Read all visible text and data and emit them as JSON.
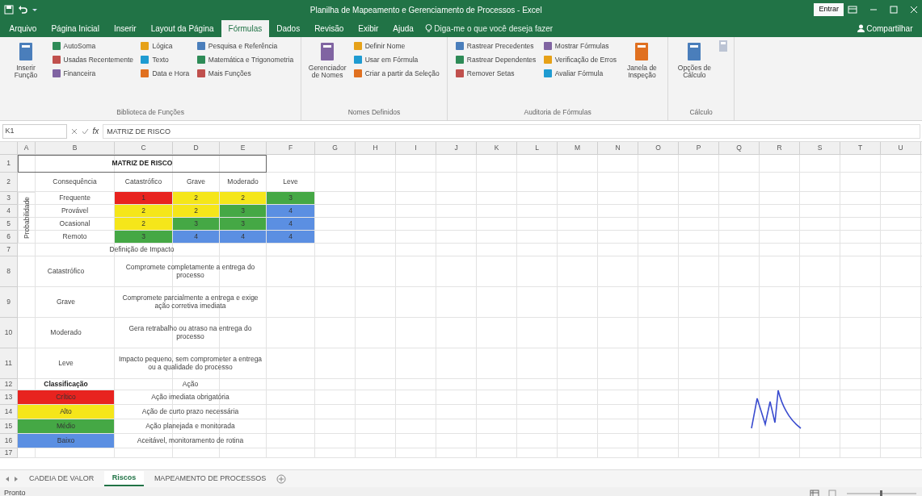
{
  "window": {
    "title": "Planilha de Mapeamento e Gerenciamento de Processos - Excel",
    "sign_in": "Entrar"
  },
  "ribbon_tabs": [
    {
      "label": "Arquivo",
      "selected": false
    },
    {
      "label": "Página Inicial",
      "selected": false
    },
    {
      "label": "Inserir",
      "selected": false
    },
    {
      "label": "Layout da Página",
      "selected": false
    },
    {
      "label": "Fórmulas",
      "selected": true
    },
    {
      "label": "Dados",
      "selected": false
    },
    {
      "label": "Revisão",
      "selected": false
    },
    {
      "label": "Exibir",
      "selected": false
    },
    {
      "label": "Ajuda",
      "selected": false
    }
  ],
  "tell_me": "Diga-me o que você deseja fazer",
  "share": "Compartilhar",
  "ribbon_groups": [
    {
      "label": "Biblioteca de Funções",
      "columns": [
        [
          {
            "label": "Inserir Função",
            "kind": "large"
          }
        ],
        [
          {
            "label": "AutoSoma",
            "kind": "small"
          },
          {
            "label": "Usadas Recentemente",
            "kind": "small"
          },
          {
            "label": "Financeira",
            "kind": "small"
          }
        ],
        [
          {
            "label": "Lógica",
            "kind": "small"
          },
          {
            "label": "Texto",
            "kind": "small"
          },
          {
            "label": "Data e Hora",
            "kind": "small"
          }
        ],
        [
          {
            "label": "Pesquisa e Referência",
            "kind": "small"
          },
          {
            "label": "Matemática e Trigonometria",
            "kind": "small"
          },
          {
            "label": "Mais Funções",
            "kind": "small"
          }
        ]
      ]
    },
    {
      "label": "Nomes Definidos",
      "columns": [
        [
          {
            "label": "Gerenciador de Nomes",
            "kind": "large"
          }
        ],
        [
          {
            "label": "Definir Nome",
            "kind": "small"
          },
          {
            "label": "Usar em Fórmula",
            "kind": "small"
          },
          {
            "label": "Criar a partir da Seleção",
            "kind": "small"
          }
        ]
      ]
    },
    {
      "label": "Auditoria de Fórmulas",
      "columns": [
        [
          {
            "label": "Rastrear Precedentes",
            "kind": "small"
          },
          {
            "label": "Rastrear Dependentes",
            "kind": "small"
          },
          {
            "label": "Remover Setas",
            "kind": "small"
          }
        ],
        [
          {
            "label": "Mostrar Fórmulas",
            "kind": "small"
          },
          {
            "label": "Verificação de Erros",
            "kind": "small"
          },
          {
            "label": "Avaliar Fórmula",
            "kind": "small"
          }
        ],
        [
          {
            "label": "Janela de Inspeção",
            "kind": "large"
          }
        ]
      ]
    },
    {
      "label": "Cálculo",
      "columns": [
        [
          {
            "label": "Opções de Cálculo",
            "kind": "large"
          }
        ],
        [
          {
            "kind": "mini"
          }
        ]
      ]
    }
  ],
  "formula_bar": {
    "name_box": "K1",
    "fx": "fx",
    "formula": "MATRIZ DE RISCO"
  },
  "row_numbers": [
    "1",
    "2",
    "3",
    "4",
    "5",
    "6",
    "7",
    "8",
    "9",
    "10",
    "11",
    "12",
    "13",
    "14",
    "15",
    "16",
    "17"
  ],
  "column_letters": [
    "A",
    "B",
    "C",
    "D",
    "E",
    "F",
    "G",
    "H",
    "I",
    "J",
    "K",
    "L",
    "M",
    "N",
    "O",
    "P",
    "Q",
    "R",
    "S",
    "T",
    "U"
  ],
  "matrix": {
    "title": "MATRIZ DE RISCO",
    "corner": "Consequência",
    "axis": "Probabilidade",
    "columns": [
      "Catastrófico",
      "Grave",
      "Moderado",
      "Leve"
    ],
    "rows": [
      {
        "label": "Frequente",
        "cells": [
          {
            "value": "1",
            "color": "#e8231f"
          },
          {
            "value": "2",
            "color": "#f5e61a"
          },
          {
            "value": "2",
            "color": "#f5e61a"
          },
          {
            "value": "3",
            "color": "#45a845"
          }
        ]
      },
      {
        "label": "Provável",
        "cells": [
          {
            "value": "2",
            "color": "#f5e61a"
          },
          {
            "value": "2",
            "color": "#f5e61a"
          },
          {
            "value": "3",
            "color": "#45a845"
          },
          {
            "value": "4",
            "color": "#5b8fe2"
          }
        ]
      },
      {
        "label": "Ocasional",
        "cells": [
          {
            "value": "2",
            "color": "#f5e61a"
          },
          {
            "value": "3",
            "color": "#45a845"
          },
          {
            "value": "3",
            "color": "#45a845"
          },
          {
            "value": "4",
            "color": "#5b8fe2"
          }
        ]
      },
      {
        "label": "Remoto",
        "cells": [
          {
            "value": "3",
            "color": "#45a845"
          },
          {
            "value": "4",
            "color": "#5b8fe2"
          },
          {
            "value": "4",
            "color": "#5b8fe2"
          },
          {
            "value": "4",
            "color": "#5b8fe2"
          }
        ]
      }
    ]
  },
  "definitions": {
    "heading": "Definição de Impacto",
    "rows": [
      {
        "label": "Catastrófico",
        "text": "Compromete completamente a entrega do processo"
      },
      {
        "label": "Grave",
        "text": "Compromete parcialmente a entrega e exige ação corretiva imediata"
      },
      {
        "label": "Moderado",
        "text": "Gera retrabalho ou atraso na entrega do processo"
      },
      {
        "label": "Leve",
        "text": "Impacto pequeno, sem comprometer a entrega ou a qualidade do processo"
      }
    ]
  },
  "legend": {
    "heading_class": "Classificação",
    "heading_action": "Ação",
    "rows": [
      {
        "label": "Crítico",
        "color": "#e8231f",
        "action": "Ação imediata obrigatória"
      },
      {
        "label": "Alto",
        "color": "#f5e61a",
        "action": "Ação de curto prazo necessária"
      },
      {
        "label": "Médio",
        "color": "#45a845",
        "action": "Ação planejada e monitorada"
      },
      {
        "label": "Baixo",
        "color": "#5b8fe2",
        "action": "Aceitável, monitoramento de rotina"
      }
    ]
  },
  "sheet_tabs": [
    {
      "label": "CADEIA DE VALOR",
      "selected": false
    },
    {
      "label": "Riscos",
      "selected": true
    },
    {
      "label": "MAPEAMENTO DE PROCESSOS",
      "selected": false
    }
  ],
  "status": "Pronto"
}
